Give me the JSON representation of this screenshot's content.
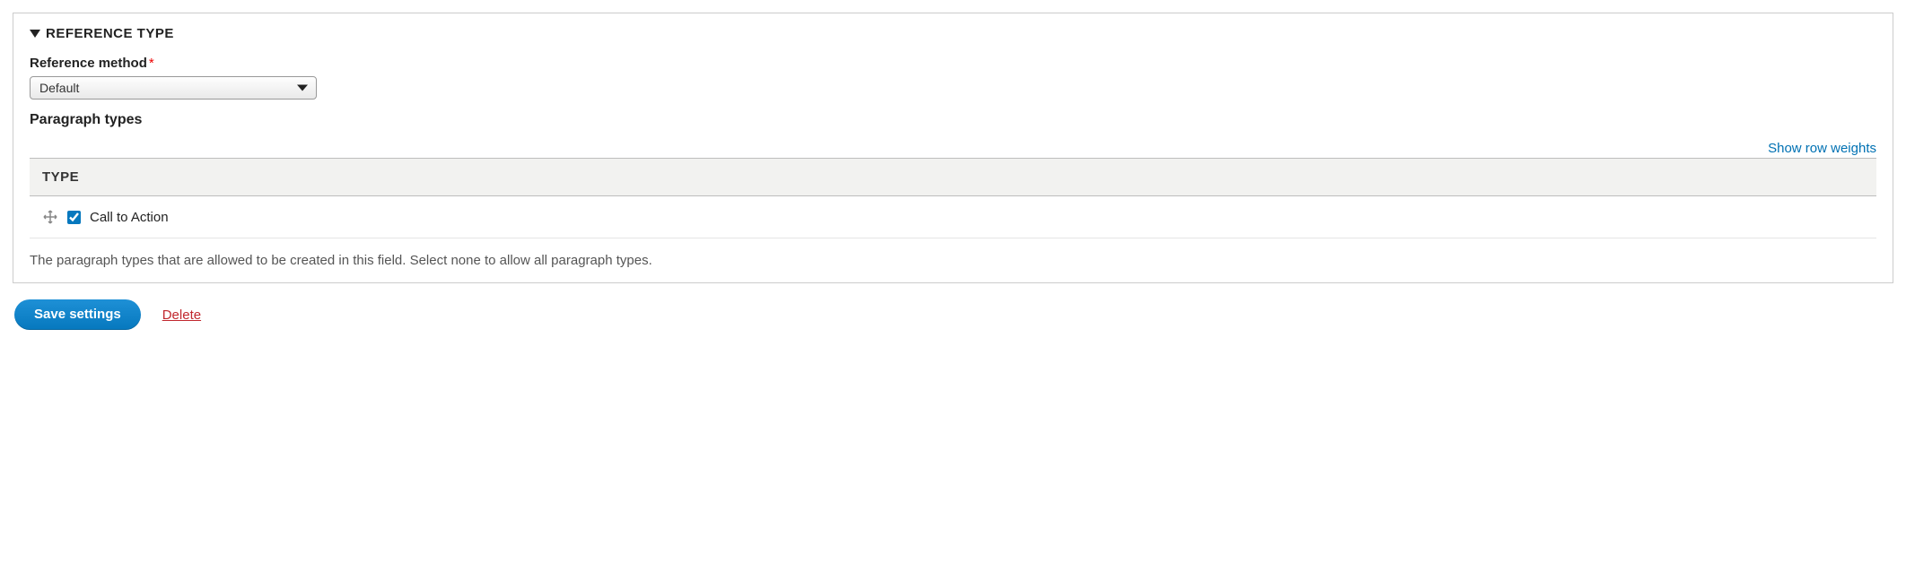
{
  "fieldset": {
    "title": "REFERENCE TYPE",
    "reference_method": {
      "label": "Reference method",
      "selected": "Default"
    },
    "paragraph_types": {
      "label": "Paragraph types",
      "show_weights": "Show row weights",
      "header": "TYPE",
      "rows": [
        {
          "label": "Call to Action",
          "checked": true
        }
      ],
      "description": "The paragraph types that are allowed to be created in this field. Select none to allow all paragraph types."
    }
  },
  "actions": {
    "save": "Save settings",
    "delete": "Delete"
  }
}
